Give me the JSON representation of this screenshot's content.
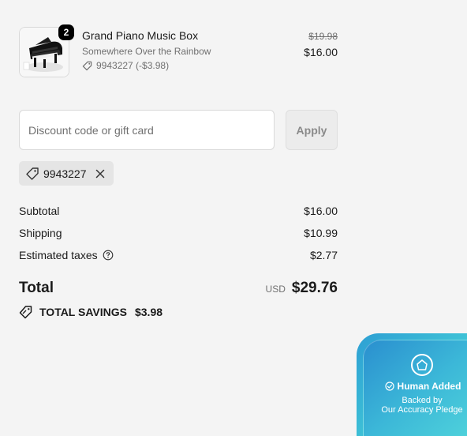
{
  "product": {
    "name": "Grand Piano Music Box",
    "variant": "Somewhere Over the Rainbow",
    "discount_line": "9943227 (-$3.98)",
    "original_price": "$19.98",
    "price": "$16.00",
    "quantity": "2",
    "thumbnail_icon": "piano-music-box-image"
  },
  "discount": {
    "placeholder": "Discount code or gift card",
    "value": "",
    "apply_label": "Apply",
    "applied_code": "9943227"
  },
  "summary": {
    "subtotal_label": "Subtotal",
    "subtotal_value": "$16.00",
    "shipping_label": "Shipping",
    "shipping_value": "$10.99",
    "taxes_label": "Estimated taxes",
    "taxes_value": "$2.77",
    "total_label": "Total",
    "currency": "USD",
    "total_value": "$29.76",
    "savings_label": "TOTAL SAVINGS",
    "savings_value": "$3.98"
  },
  "pledge": {
    "title": "Human Added",
    "subtitle_1": "Backed by",
    "subtitle_2": "Our Accuracy Pledge"
  },
  "colors": {
    "background": "#f4f4f4",
    "text": "#1a1a1a",
    "muted": "#707070",
    "badge_gradient_start": "#2a8fcf",
    "badge_gradient_end": "#52d6db"
  }
}
